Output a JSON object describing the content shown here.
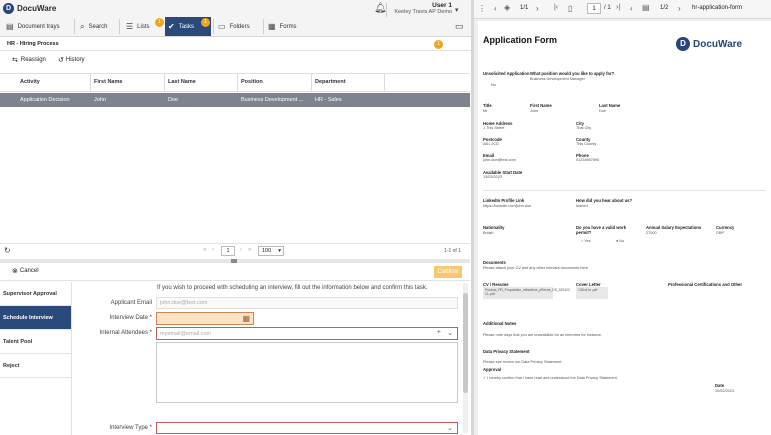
{
  "app": {
    "brand": "DocuWare"
  },
  "user": {
    "name": "User 1",
    "org": "Keeley Travis AP Demo"
  },
  "nav": {
    "document_trays": "Document trays",
    "search": "Search",
    "lists": "Lists",
    "lists_badge": "1",
    "tasks": "Tasks",
    "tasks_badge": "1",
    "folders": "Folders",
    "forms": "Forms"
  },
  "task": {
    "title": "HR - Hiring Process",
    "info_badge": "1",
    "reassign": "Reassign",
    "history": "History",
    "columns": [
      "Activity",
      "First Name",
      "Last Name",
      "Position",
      "Department"
    ],
    "row": [
      "Application Decision",
      "John",
      "Doe",
      "Business Development ...",
      "HR - Sales"
    ]
  },
  "pager": {
    "page": "1",
    "per_page": "100",
    "range": "1-1 of 1"
  },
  "form": {
    "cancel": "Cancel",
    "confirm": "Confirm",
    "intro": "If you wish to proceed with scheduling an interview, fill out the information below and confirm this task.",
    "nav": [
      "Supervisor Approval",
      "Schedule Interview",
      "Talent Pool",
      "Reject"
    ],
    "applicant_email_label": "Applicant Email",
    "applicant_email_value": "john.doe@test.com",
    "interview_date_label": "Interview Date *",
    "attendees_label": "Internal Attendees *",
    "attendees_placeholder": "myemail@email.com",
    "interview_type_label": "Interview Type *"
  },
  "viewer": {
    "page_a": "1/1",
    "page_input": "1",
    "page_b_total": "/ 1",
    "page_c": "1/2",
    "doc_name": "hr-application-form"
  },
  "doc": {
    "title": "Application Form",
    "brand": "DocuWare",
    "unsolicited_label": "Unsolicited Application",
    "unsolicited_value": "No",
    "position_label": "What position would you like to apply for?",
    "position_value": "Business Development Manager",
    "title_label": "Title",
    "title_value": "Mr",
    "first_name_label": "First Name",
    "first_name_value": "John",
    "last_name_label": "Last Name",
    "last_name_value": "Doe",
    "home_address_label": "Home Address",
    "home_address_value": "1 This Street",
    "city_label": "City",
    "city_value": "That City",
    "postcode_label": "Postcode",
    "postcode_value": "AB1 2CD",
    "county_label": "County",
    "county_value": "This County",
    "email_label": "Email",
    "email_value": "john.doe@test.com",
    "phone_label": "Phone",
    "phone_value": "01234567890",
    "start_date_label": "Available Start Date",
    "start_date_value": "13/03/2023",
    "linkedin_label": "LinkedIn Profile Link",
    "linkedin_value": "https://linkedin.com/john.doe",
    "hear_label": "How did you hear about us?",
    "hear_value": "Indeed",
    "nationality_label": "Nationality",
    "nationality_value": "British",
    "work_permit_label": "Do you have a valid work permit?",
    "work_permit_yes": "Yes",
    "work_permit_no": "No",
    "salary_label": "Annual Salary Expectations",
    "salary_value": "27000",
    "currency_label": "Currency",
    "currency_value": "GBP",
    "documents_heading": "Documents",
    "documents_hint": "Please attach your CV and any other relevant documents here.",
    "cv_label": "CV / Resume",
    "cv_value": "Product_PR_Proposition_mtbuttbox_pReves_DS_329423 CL.pdf",
    "cover_label": "Cover Letter",
    "cover_value": "132nd to .pdf",
    "certs_label": "Professional Certifications and Other",
    "notes_heading": "Additional Notes",
    "notes_hint": "Please note days that you are unavailable for an interview for instance.",
    "privacy_heading": "Data Privacy Statement",
    "privacy_text": "Please see review our Data Privacy Statement.",
    "approval_heading": "Approval",
    "approval_text": "I hereby confirm that I have read and understood the Data Privacy Statement.",
    "date_label": "Date",
    "date_value": "10/02/2023"
  },
  "colors": {
    "primary": "#2b4a7c",
    "accent": "#f1a51f",
    "selected_row": "#7d848f",
    "required_border": "#c45a5a"
  }
}
